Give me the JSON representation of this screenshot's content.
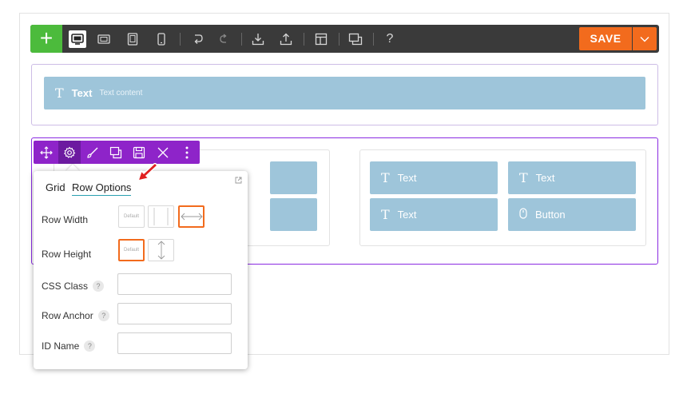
{
  "toolbar": {
    "add_label": "+",
    "save_label": "SAVE",
    "help_label": "?",
    "buttons": [
      "desktop-icon",
      "tablet-landscape-icon",
      "tablet-portrait-icon",
      "mobile-icon",
      "undo-icon",
      "redo-icon",
      "import-icon",
      "export-icon",
      "layout-icon",
      "duplicate-icon"
    ]
  },
  "row1": {
    "module": {
      "title": "Text",
      "subtitle": "Text content"
    }
  },
  "row2": {
    "modules": [
      {
        "title": "Text"
      },
      {
        "title": "Text"
      },
      {
        "title": "Text"
      },
      {
        "title": "Button"
      }
    ]
  },
  "panel": {
    "tabs": [
      "Grid",
      "Row Options"
    ],
    "active_tab": "Row Options",
    "row_width_label": "Row Width",
    "row_height_label": "Row Height",
    "css_class_label": "CSS Class",
    "row_anchor_label": "Row Anchor",
    "id_name_label": "ID Name",
    "help": "?",
    "default_label": "Default",
    "css_class_value": "",
    "row_anchor_value": "",
    "id_name_value": ""
  },
  "colors": {
    "accent": "#f26b1d",
    "row_toolbar": "#8e24c9",
    "module": "#9ec5da",
    "add": "#4cbb3c"
  }
}
